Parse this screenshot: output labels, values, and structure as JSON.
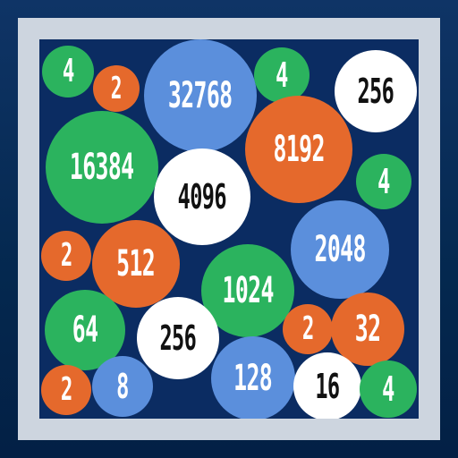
{
  "colors": {
    "background": "#0b2c62",
    "frame": "#cdd5df",
    "green": "#2bb35e",
    "orange": "#e5692c",
    "blue": "#5b8fdc",
    "white": "#ffffff"
  },
  "tiles": [
    {
      "value": "4",
      "color": "green"
    },
    {
      "value": "2",
      "color": "orange"
    },
    {
      "value": "32768",
      "color": "blue"
    },
    {
      "value": "4",
      "color": "green"
    },
    {
      "value": "256",
      "color": "white"
    },
    {
      "value": "16384",
      "color": "green"
    },
    {
      "value": "8192",
      "color": "orange"
    },
    {
      "value": "4096",
      "color": "white"
    },
    {
      "value": "4",
      "color": "green"
    },
    {
      "value": "2048",
      "color": "blue"
    },
    {
      "value": "2",
      "color": "orange"
    },
    {
      "value": "512",
      "color": "orange"
    },
    {
      "value": "1024",
      "color": "green"
    },
    {
      "value": "64",
      "color": "green"
    },
    {
      "value": "256",
      "color": "white"
    },
    {
      "value": "2",
      "color": "orange"
    },
    {
      "value": "32",
      "color": "orange"
    },
    {
      "value": "2",
      "color": "orange"
    },
    {
      "value": "8",
      "color": "blue"
    },
    {
      "value": "128",
      "color": "blue"
    },
    {
      "value": "16",
      "color": "white"
    },
    {
      "value": "4",
      "color": "green"
    }
  ]
}
